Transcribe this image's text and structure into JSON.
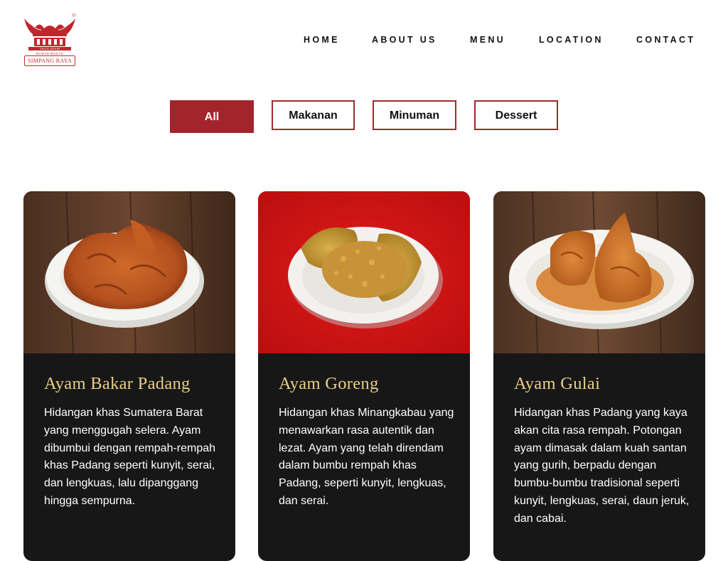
{
  "brand": {
    "name": "SIMPANG RAYA",
    "tagline": "RUMAH MAKAN",
    "mark_label": "TAGA AYAM",
    "color": "#c0272d"
  },
  "nav": {
    "items": [
      {
        "label": "HOME"
      },
      {
        "label": "ABOUT US"
      },
      {
        "label": "MENU"
      },
      {
        "label": "LOCATION"
      },
      {
        "label": "CONTACT"
      }
    ]
  },
  "filters": {
    "active": "All",
    "items": [
      {
        "label": "All"
      },
      {
        "label": "Makanan"
      },
      {
        "label": "Minuman"
      },
      {
        "label": "Dessert"
      }
    ]
  },
  "colors": {
    "accent": "#a3242b",
    "card_bg": "#171717",
    "title_gold": "#e8cf86"
  },
  "menu": {
    "items": [
      {
        "title": "Ayam Bakar Padang",
        "description": "Hidangan khas Sumatera Barat yang menggugah selera. Ayam dibumbui dengan rempah-rempah khas Padang seperti kunyit, serai, dan lengkuas, lalu dipanggang hingga sempurna.",
        "image": "grilled-chicken-photo"
      },
      {
        "title": "Ayam Goreng",
        "description": "Hidangan khas Minangkabau yang menawarkan rasa autentik dan lezat. Ayam yang telah direndam dalam bumbu rempah khas Padang, seperti kunyit, lengkuas, dan serai.",
        "image": "fried-chicken-photo"
      },
      {
        "title": "Ayam Gulai",
        "description": "Hidangan khas Padang yang kaya akan cita rasa rempah. Potongan ayam dimasak dalam kuah santan yang gurih, berpadu dengan bumbu-bumbu tradisional seperti kunyit, lengkuas, serai, daun jeruk, dan cabai.",
        "image": "curry-chicken-photo"
      }
    ]
  }
}
